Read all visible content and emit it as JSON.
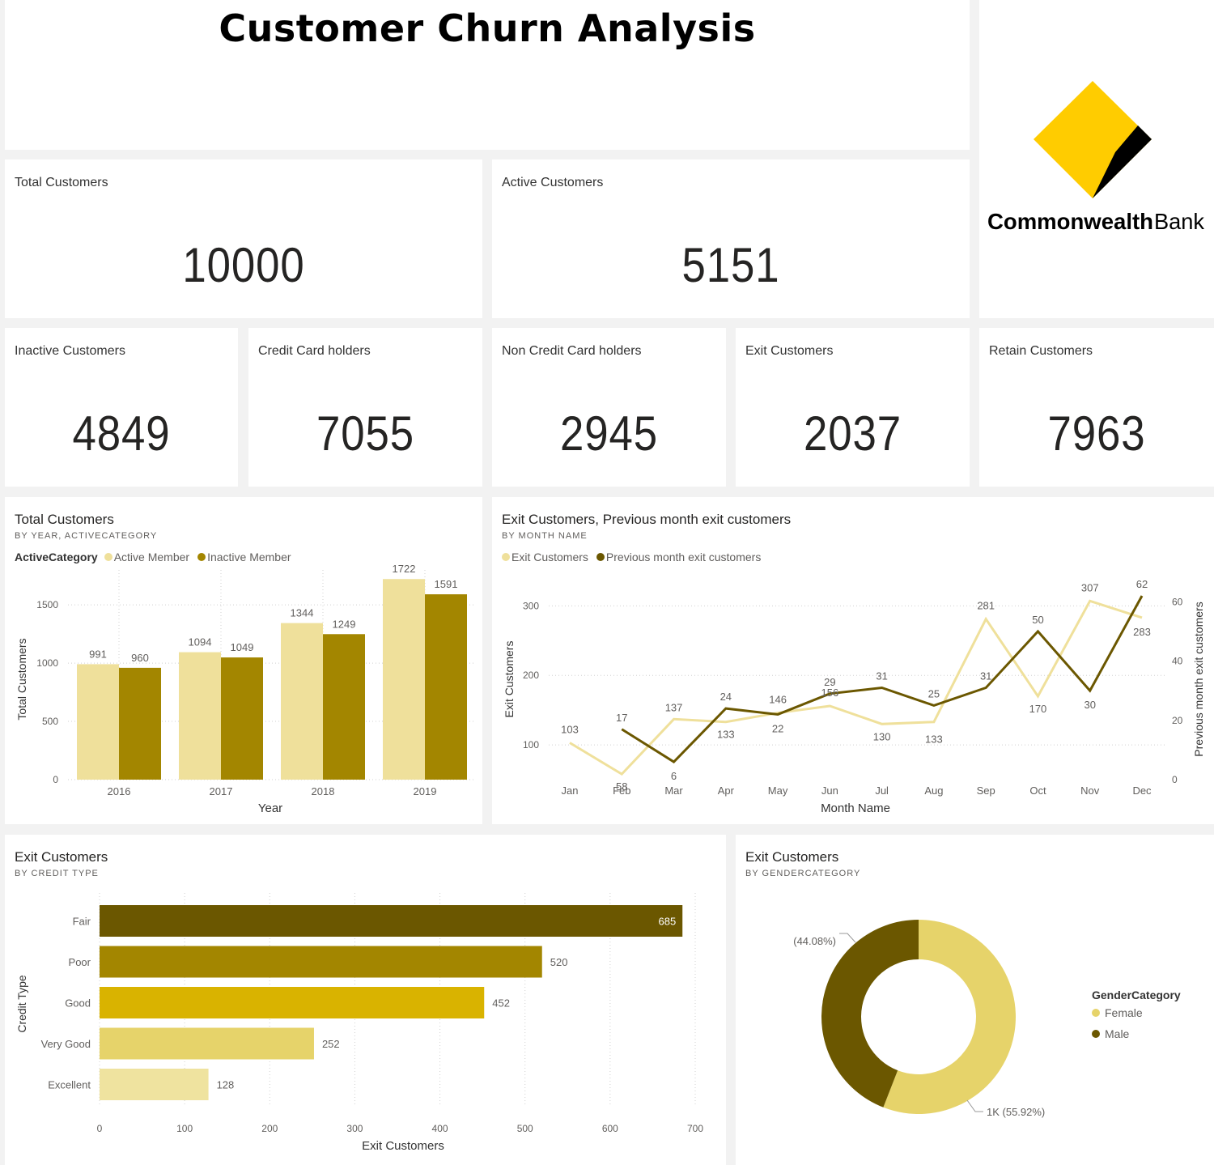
{
  "page_title": "Customer Churn Analysis",
  "logo": {
    "text_bold": "Commonwealth",
    "text_light": "Bank",
    "colors": {
      "diamond": "#ffcc00",
      "stripe": "#000000"
    }
  },
  "kpis": {
    "total_customers": {
      "label": "Total Customers",
      "value": "10000"
    },
    "active_customers": {
      "label": "Active Customers",
      "value": "5151"
    },
    "inactive_customers": {
      "label": "Inactive Customers",
      "value": "4849"
    },
    "credit_card_holders": {
      "label": "Credit Card holders",
      "value": "7055"
    },
    "non_credit_card_holders": {
      "label": "Non Credit Card holders",
      "value": "2945"
    },
    "exit_customers": {
      "label": "Exit Customers",
      "value": "2037"
    },
    "retain_customers": {
      "label": "Retain Customers",
      "value": "7963"
    }
  },
  "colors": {
    "light": "#efe09b",
    "mid": "#a38600",
    "dark": "#6b5700",
    "gold": "#d9b300",
    "pale": "#e6d36a",
    "palest": "#efe39f"
  },
  "chart_data": [
    {
      "id": "year_chart",
      "type": "bar",
      "title": "Total Customers",
      "subtitle": "BY YEAR, ACTIVECATEGORY",
      "legend_title": "ActiveCategory",
      "categories": [
        "2016",
        "2017",
        "2018",
        "2019"
      ],
      "series": [
        {
          "name": "Active Member",
          "values": [
            991,
            1094,
            1344,
            1722
          ]
        },
        {
          "name": "Inactive Member",
          "values": [
            960,
            1049,
            1249,
            1591
          ]
        }
      ],
      "xlabel": "Year",
      "ylabel": "Total Customers",
      "ylim": [
        0,
        1800
      ],
      "yticks": [
        0,
        500,
        1000,
        1500
      ],
      "grid": true
    },
    {
      "id": "month_chart",
      "type": "line",
      "title": "Exit Customers, Previous month exit customers",
      "subtitle": "BY MONTH NAME",
      "categories": [
        "Jan",
        "Feb",
        "Mar",
        "Apr",
        "May",
        "Jun",
        "Jul",
        "Aug",
        "Sep",
        "Oct",
        "Nov",
        "Dec"
      ],
      "series": [
        {
          "name": "Exit Customers",
          "axis": "left",
          "values": [
            103,
            58,
            137,
            133,
            146,
            156,
            130,
            133,
            281,
            170,
            307,
            283
          ]
        },
        {
          "name": "Previous month exit customers",
          "axis": "right",
          "values": [
            null,
            17,
            6,
            24,
            22,
            29,
            31,
            25,
            31,
            50,
            30,
            62
          ]
        }
      ],
      "xlabel": "Month Name",
      "ylabel": "Exit Customers",
      "y2label": "Previous month exit customers",
      "ylim": [
        50,
        340
      ],
      "yticks": [
        100,
        200,
        300
      ],
      "y2lim": [
        0,
        68
      ],
      "y2ticks": [
        0,
        20,
        40,
        60
      ],
      "grid": true
    },
    {
      "id": "credit_chart",
      "type": "bar",
      "orientation": "horizontal",
      "title": "Exit Customers",
      "subtitle": "BY CREDIT TYPE",
      "categories": [
        "Fair",
        "Poor",
        "Good",
        "Very Good",
        "Excellent"
      ],
      "values": [
        685,
        520,
        452,
        252,
        128
      ],
      "xlabel": "Exit Customers",
      "ylabel": "Credit Type",
      "xlim": [
        0,
        700
      ],
      "xticks": [
        0,
        100,
        200,
        300,
        400,
        500,
        600,
        700
      ],
      "grid": true
    },
    {
      "id": "gender_chart",
      "type": "pie",
      "title": "Exit Customers",
      "subtitle": "BY GENDERCATEGORY",
      "legend_title": "GenderCategory",
      "categories": [
        "Female",
        "Male"
      ],
      "values": [
        55.92,
        44.08
      ],
      "labels": [
        "1K (55.92%)",
        "(44.08%)"
      ]
    }
  ]
}
